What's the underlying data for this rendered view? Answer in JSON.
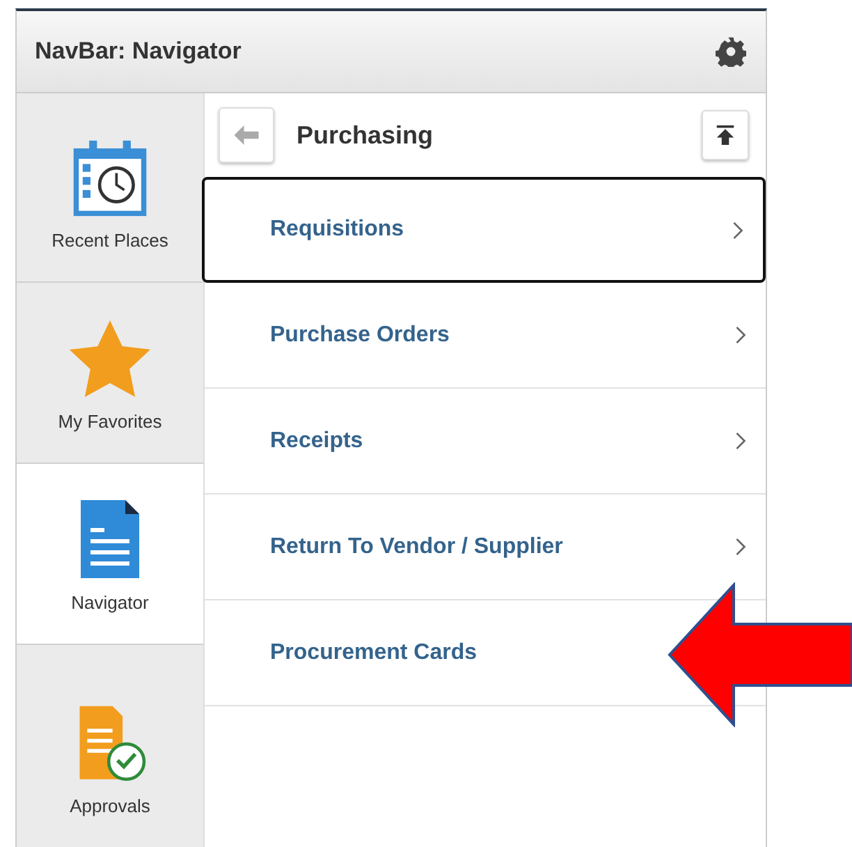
{
  "header": {
    "title": "NavBar: Navigator"
  },
  "sidebar": {
    "items": [
      {
        "label": "Recent Places",
        "selected": false
      },
      {
        "label": "My Favorites",
        "selected": false
      },
      {
        "label": "Navigator",
        "selected": true
      },
      {
        "label": "Approvals",
        "selected": false
      }
    ]
  },
  "content": {
    "title": "Purchasing",
    "items": [
      {
        "label": "Requisitions",
        "focused": true
      },
      {
        "label": "Purchase Orders",
        "focused": false
      },
      {
        "label": "Receipts",
        "focused": false
      },
      {
        "label": "Return To Vendor / Supplier",
        "focused": false
      },
      {
        "label": "Procurement Cards",
        "focused": false
      }
    ]
  }
}
